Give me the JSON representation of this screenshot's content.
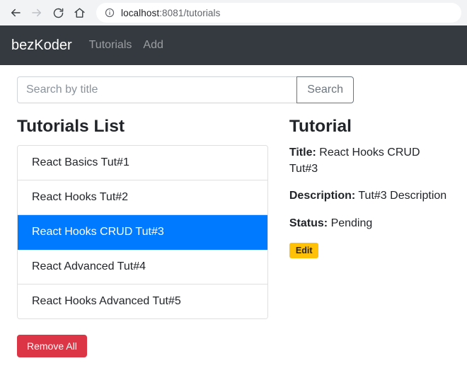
{
  "browser": {
    "back_icon": "arrow-left-icon",
    "forward_icon": "arrow-right-icon",
    "reload_icon": "reload-icon",
    "home_icon": "home-icon",
    "info_icon": "info-circle-icon",
    "url_host": "localhost",
    "url_path": ":8081/tutorials"
  },
  "navbar": {
    "brand": "bezKoder",
    "links": [
      {
        "label": "Tutorials"
      },
      {
        "label": "Add"
      }
    ]
  },
  "search": {
    "value": "",
    "placeholder": "Search by title",
    "button_label": "Search"
  },
  "list_panel": {
    "heading": "Tutorials List",
    "items": [
      {
        "label": "React Basics Tut#1",
        "active": false
      },
      {
        "label": "React Hooks Tut#2",
        "active": false
      },
      {
        "label": "React Hooks CRUD Tut#3",
        "active": true
      },
      {
        "label": "React Advanced Tut#4",
        "active": false
      },
      {
        "label": "React Hooks Advanced Tut#5",
        "active": false
      }
    ],
    "remove_all_label": "Remove All"
  },
  "detail_panel": {
    "heading": "Tutorial",
    "title_label": "Title:",
    "title_value": "React Hooks CRUD Tut#3",
    "description_label": "Description:",
    "description_value": "Tut#3 Description",
    "status_label": "Status:",
    "status_value": "Pending",
    "edit_label": "Edit"
  },
  "colors": {
    "navbar_bg": "#343a40",
    "active_item": "#007bff",
    "danger": "#dc3545",
    "warning": "#ffc107",
    "chrome_bg": "#f1f3f4"
  }
}
